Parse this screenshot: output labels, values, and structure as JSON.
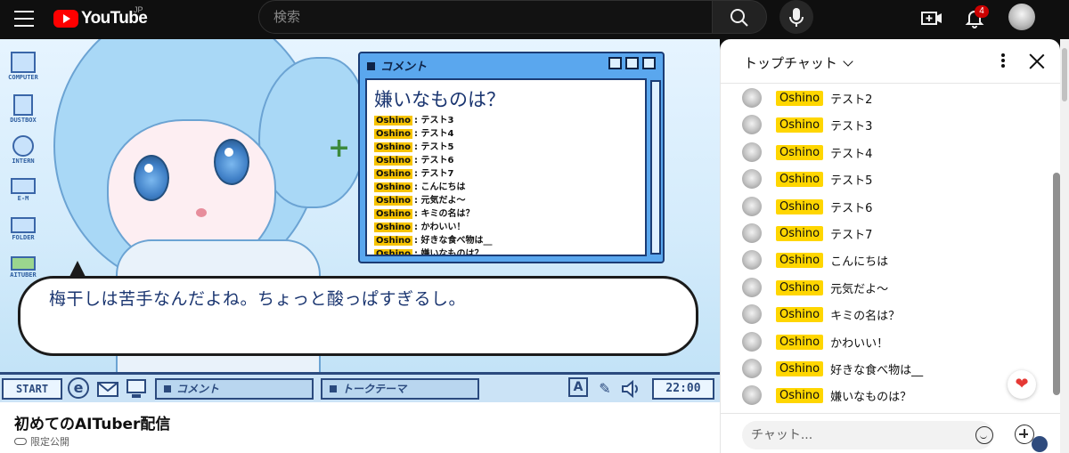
{
  "header": {
    "logo_text": "YouTube",
    "country_code": "JP",
    "search_placeholder": "検索",
    "notifications_count": "4"
  },
  "video": {
    "desktop_icons": [
      {
        "label": "COMPUTER",
        "icon": "computer-icon"
      },
      {
        "label": "DUSTBOX",
        "icon": "trash-icon"
      },
      {
        "label": "INTERN",
        "icon": "browser-icon"
      },
      {
        "label": "E-M",
        "icon": "mail-icon"
      },
      {
        "label": "FOLDER",
        "icon": "folder-icon"
      },
      {
        "label": "AITUBER",
        "icon": "aituber-icon"
      }
    ],
    "comment_window": {
      "title": "コメント",
      "question": "嫌いなものは？",
      "lines": [
        {
          "user": "Oshino",
          "text": "テスト3"
        },
        {
          "user": "Oshino",
          "text": "テスト4"
        },
        {
          "user": "Oshino",
          "text": "テスト5"
        },
        {
          "user": "Oshino",
          "text": "テスト6"
        },
        {
          "user": "Oshino",
          "text": "テスト7"
        },
        {
          "user": "Oshino",
          "text": "こんにちは"
        },
        {
          "user": "Oshino",
          "text": "元気だよ～"
        },
        {
          "user": "Oshino",
          "text": "キミの名は？"
        },
        {
          "user": "Oshino",
          "text": "かわいい！"
        },
        {
          "user": "Oshino",
          "text": "好きな食べ物は__"
        },
        {
          "user": "Oshino",
          "text": "嫌いなものは？"
        }
      ]
    },
    "speech_text": "梅干しは苦手なんだよね。ちょっと酸っぱすぎるし。",
    "taskbar": {
      "start": "START",
      "task_comment": "コメント",
      "task_topic": "トークテーマ",
      "clock": "22:00"
    }
  },
  "below_video": {
    "title": "初めてのAITuber配信",
    "visibility": "限定公開"
  },
  "chat": {
    "header_title": "トップチャット",
    "messages": [
      {
        "user": "Oshino",
        "text": "テスト2"
      },
      {
        "user": "Oshino",
        "text": "テスト3"
      },
      {
        "user": "Oshino",
        "text": "テスト4"
      },
      {
        "user": "Oshino",
        "text": "テスト5"
      },
      {
        "user": "Oshino",
        "text": "テスト6"
      },
      {
        "user": "Oshino",
        "text": "テスト7"
      },
      {
        "user": "Oshino",
        "text": "こんにちは"
      },
      {
        "user": "Oshino",
        "text": "元気だよ～"
      },
      {
        "user": "Oshino",
        "text": "キミの名は？"
      },
      {
        "user": "Oshino",
        "text": "かわいい！"
      },
      {
        "user": "Oshino",
        "text": "好きな食べ物は__"
      },
      {
        "user": "Oshino",
        "text": "嫌いなものは？"
      }
    ],
    "input_placeholder": "チャット...",
    "reaction_icon": "heart-icon"
  },
  "colors": {
    "brand_red": "#ff0000",
    "username_highlight": "#ffd600",
    "window_blue": "#5aa7ee"
  }
}
